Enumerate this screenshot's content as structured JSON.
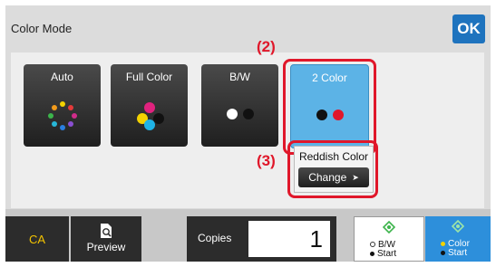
{
  "header": {
    "title": "Color Mode",
    "ok_label": "OK"
  },
  "modes": [
    {
      "label": "Auto",
      "icon": "auto-color-dots-icon"
    },
    {
      "label": "Full Color",
      "icon": "full-color-dots-icon"
    },
    {
      "label": "B/W",
      "icon": "bw-dots-icon"
    },
    {
      "label": "2 Color",
      "icon": "two-color-dots-icon",
      "selected": true
    }
  ],
  "callouts": {
    "step2": "(2)",
    "step3": "(3)"
  },
  "reddish": {
    "label": "Reddish Color",
    "change_label": "Change"
  },
  "bottom_bar": {
    "ca_label": "CA",
    "preview_label": "Preview",
    "copies_label": "Copies",
    "copies_value": "1",
    "bw_start": {
      "line1": "B/W",
      "line2": "Start"
    },
    "color_start": {
      "line1": "Color",
      "line2": "Start"
    }
  },
  "colors": {
    "accent": "#1e73be",
    "selected": "#5cb3e6",
    "highlight": "#e0172a",
    "ca_text": "#f3c300",
    "start_green": "#3cb44b"
  }
}
